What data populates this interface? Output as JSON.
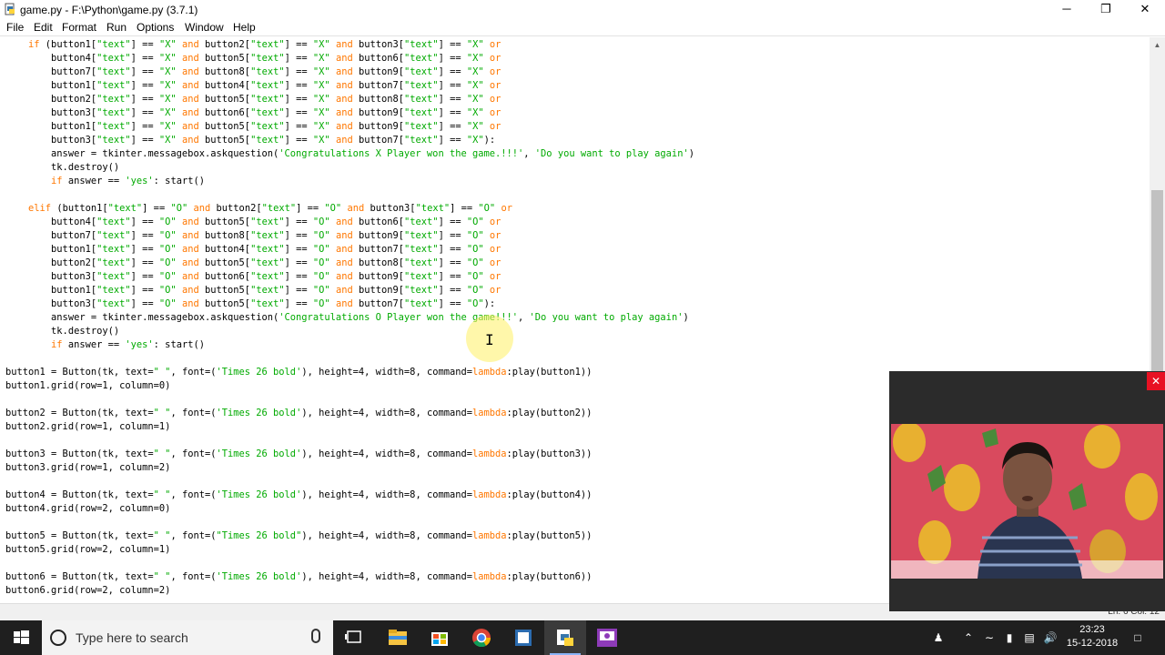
{
  "window": {
    "title": "game.py - F:\\Python\\game.py (3.7.1)",
    "minimize": "─",
    "maximize": "❐",
    "close": "✕"
  },
  "menu": [
    "File",
    "Edit",
    "Format",
    "Run",
    "Options",
    "Window",
    "Help"
  ],
  "code_lines": [
    [
      [
        "    ",
        ""
      ],
      [
        "if",
        "kw"
      ],
      [
        " (button1[",
        ""
      ],
      [
        "\"text\"",
        "str"
      ],
      [
        "] == ",
        ""
      ],
      [
        "\"X\"",
        "str"
      ],
      [
        " ",
        ""
      ],
      [
        "and",
        "kw"
      ],
      [
        " button2[",
        ""
      ],
      [
        "\"text\"",
        "str"
      ],
      [
        "] == ",
        ""
      ],
      [
        "\"X\"",
        "str"
      ],
      [
        " ",
        ""
      ],
      [
        "and",
        "kw"
      ],
      [
        " button3[",
        ""
      ],
      [
        "\"text\"",
        "str"
      ],
      [
        "] == ",
        ""
      ],
      [
        "\"X\"",
        "str"
      ],
      [
        " ",
        ""
      ],
      [
        "or",
        "kw"
      ]
    ],
    [
      [
        "        button4[",
        ""
      ],
      [
        "\"text\"",
        "str"
      ],
      [
        "] == ",
        ""
      ],
      [
        "\"X\"",
        "str"
      ],
      [
        " ",
        ""
      ],
      [
        "and",
        "kw"
      ],
      [
        " button5[",
        ""
      ],
      [
        "\"text\"",
        "str"
      ],
      [
        "] == ",
        ""
      ],
      [
        "\"X\"",
        "str"
      ],
      [
        " ",
        ""
      ],
      [
        "and",
        "kw"
      ],
      [
        " button6[",
        ""
      ],
      [
        "\"text\"",
        "str"
      ],
      [
        "] == ",
        ""
      ],
      [
        "\"X\"",
        "str"
      ],
      [
        " ",
        ""
      ],
      [
        "or",
        "kw"
      ]
    ],
    [
      [
        "        button7[",
        ""
      ],
      [
        "\"text\"",
        "str"
      ],
      [
        "] == ",
        ""
      ],
      [
        "\"X\"",
        "str"
      ],
      [
        " ",
        ""
      ],
      [
        "and",
        "kw"
      ],
      [
        " button8[",
        ""
      ],
      [
        "\"text\"",
        "str"
      ],
      [
        "] == ",
        ""
      ],
      [
        "\"X\"",
        "str"
      ],
      [
        " ",
        ""
      ],
      [
        "and",
        "kw"
      ],
      [
        " button9[",
        ""
      ],
      [
        "\"text\"",
        "str"
      ],
      [
        "] == ",
        ""
      ],
      [
        "\"X\"",
        "str"
      ],
      [
        " ",
        ""
      ],
      [
        "or",
        "kw"
      ]
    ],
    [
      [
        "        button1[",
        ""
      ],
      [
        "\"text\"",
        "str"
      ],
      [
        "] == ",
        ""
      ],
      [
        "\"X\"",
        "str"
      ],
      [
        " ",
        ""
      ],
      [
        "and",
        "kw"
      ],
      [
        " button4[",
        ""
      ],
      [
        "\"text\"",
        "str"
      ],
      [
        "] == ",
        ""
      ],
      [
        "\"X\"",
        "str"
      ],
      [
        " ",
        ""
      ],
      [
        "and",
        "kw"
      ],
      [
        " button7[",
        ""
      ],
      [
        "\"text\"",
        "str"
      ],
      [
        "] == ",
        ""
      ],
      [
        "\"X\"",
        "str"
      ],
      [
        " ",
        ""
      ],
      [
        "or",
        "kw"
      ]
    ],
    [
      [
        "        button2[",
        ""
      ],
      [
        "\"text\"",
        "str"
      ],
      [
        "] == ",
        ""
      ],
      [
        "\"X\"",
        "str"
      ],
      [
        " ",
        ""
      ],
      [
        "and",
        "kw"
      ],
      [
        " button5[",
        ""
      ],
      [
        "\"text\"",
        "str"
      ],
      [
        "] == ",
        ""
      ],
      [
        "\"X\"",
        "str"
      ],
      [
        " ",
        ""
      ],
      [
        "and",
        "kw"
      ],
      [
        " button8[",
        ""
      ],
      [
        "\"text\"",
        "str"
      ],
      [
        "] == ",
        ""
      ],
      [
        "\"X\"",
        "str"
      ],
      [
        " ",
        ""
      ],
      [
        "or",
        "kw"
      ]
    ],
    [
      [
        "        button3[",
        ""
      ],
      [
        "\"text\"",
        "str"
      ],
      [
        "] == ",
        ""
      ],
      [
        "\"X\"",
        "str"
      ],
      [
        " ",
        ""
      ],
      [
        "and",
        "kw"
      ],
      [
        " button6[",
        ""
      ],
      [
        "\"text\"",
        "str"
      ],
      [
        "] == ",
        ""
      ],
      [
        "\"X\"",
        "str"
      ],
      [
        " ",
        ""
      ],
      [
        "and",
        "kw"
      ],
      [
        " button9[",
        ""
      ],
      [
        "\"text\"",
        "str"
      ],
      [
        "] == ",
        ""
      ],
      [
        "\"X\"",
        "str"
      ],
      [
        " ",
        ""
      ],
      [
        "or",
        "kw"
      ]
    ],
    [
      [
        "        button1[",
        ""
      ],
      [
        "\"text\"",
        "str"
      ],
      [
        "] == ",
        ""
      ],
      [
        "\"X\"",
        "str"
      ],
      [
        " ",
        ""
      ],
      [
        "and",
        "kw"
      ],
      [
        " button5[",
        ""
      ],
      [
        "\"text\"",
        "str"
      ],
      [
        "] == ",
        ""
      ],
      [
        "\"X\"",
        "str"
      ],
      [
        " ",
        ""
      ],
      [
        "and",
        "kw"
      ],
      [
        " button9[",
        ""
      ],
      [
        "\"text\"",
        "str"
      ],
      [
        "] == ",
        ""
      ],
      [
        "\"X\"",
        "str"
      ],
      [
        " ",
        ""
      ],
      [
        "or",
        "kw"
      ]
    ],
    [
      [
        "        button3[",
        ""
      ],
      [
        "\"text\"",
        "str"
      ],
      [
        "] == ",
        ""
      ],
      [
        "\"X\"",
        "str"
      ],
      [
        " ",
        ""
      ],
      [
        "and",
        "kw"
      ],
      [
        " button5[",
        ""
      ],
      [
        "\"text\"",
        "str"
      ],
      [
        "] == ",
        ""
      ],
      [
        "\"X\"",
        "str"
      ],
      [
        " ",
        ""
      ],
      [
        "and",
        "kw"
      ],
      [
        " button7[",
        ""
      ],
      [
        "\"text\"",
        "str"
      ],
      [
        "] == ",
        ""
      ],
      [
        "\"X\"",
        "str"
      ],
      [
        "):",
        ""
      ]
    ],
    [
      [
        "        answer = tkinter.messagebox.askquestion(",
        ""
      ],
      [
        "'Congratulations X Player won the game.!!!'",
        "str"
      ],
      [
        ", ",
        ""
      ],
      [
        "'Do you want to play again'",
        "str"
      ],
      [
        ")",
        ""
      ]
    ],
    [
      [
        "        tk.destroy()",
        ""
      ]
    ],
    [
      [
        "        ",
        ""
      ],
      [
        "if",
        "kw"
      ],
      [
        " answer == ",
        ""
      ],
      [
        "'yes'",
        "str"
      ],
      [
        ": start()",
        ""
      ]
    ],
    [
      [
        "",
        ""
      ]
    ],
    [
      [
        "    ",
        ""
      ],
      [
        "elif",
        "kw"
      ],
      [
        " (button1[",
        ""
      ],
      [
        "\"text\"",
        "str"
      ],
      [
        "] == ",
        ""
      ],
      [
        "\"O\"",
        "str"
      ],
      [
        " ",
        ""
      ],
      [
        "and",
        "kw"
      ],
      [
        " button2[",
        ""
      ],
      [
        "\"text\"",
        "str"
      ],
      [
        "] == ",
        ""
      ],
      [
        "\"O\"",
        "str"
      ],
      [
        " ",
        ""
      ],
      [
        "and",
        "kw"
      ],
      [
        " button3[",
        ""
      ],
      [
        "\"text\"",
        "str"
      ],
      [
        "] == ",
        ""
      ],
      [
        "\"O\"",
        "str"
      ],
      [
        " ",
        ""
      ],
      [
        "or",
        "kw"
      ]
    ],
    [
      [
        "        button4[",
        ""
      ],
      [
        "\"text\"",
        "str"
      ],
      [
        "] == ",
        ""
      ],
      [
        "\"O\"",
        "str"
      ],
      [
        " ",
        ""
      ],
      [
        "and",
        "kw"
      ],
      [
        " button5[",
        ""
      ],
      [
        "\"text\"",
        "str"
      ],
      [
        "] == ",
        ""
      ],
      [
        "\"O\"",
        "str"
      ],
      [
        " ",
        ""
      ],
      [
        "and",
        "kw"
      ],
      [
        " button6[",
        ""
      ],
      [
        "\"text\"",
        "str"
      ],
      [
        "] == ",
        ""
      ],
      [
        "\"O\"",
        "str"
      ],
      [
        " ",
        ""
      ],
      [
        "or",
        "kw"
      ]
    ],
    [
      [
        "        button7[",
        ""
      ],
      [
        "\"text\"",
        "str"
      ],
      [
        "] == ",
        ""
      ],
      [
        "\"O\"",
        "str"
      ],
      [
        " ",
        ""
      ],
      [
        "and",
        "kw"
      ],
      [
        " button8[",
        ""
      ],
      [
        "\"text\"",
        "str"
      ],
      [
        "] == ",
        ""
      ],
      [
        "\"O\"",
        "str"
      ],
      [
        " ",
        ""
      ],
      [
        "and",
        "kw"
      ],
      [
        " button9[",
        ""
      ],
      [
        "\"text\"",
        "str"
      ],
      [
        "] == ",
        ""
      ],
      [
        "\"O\"",
        "str"
      ],
      [
        " ",
        ""
      ],
      [
        "or",
        "kw"
      ]
    ],
    [
      [
        "        button1[",
        ""
      ],
      [
        "\"text\"",
        "str"
      ],
      [
        "] == ",
        ""
      ],
      [
        "\"O\"",
        "str"
      ],
      [
        " ",
        ""
      ],
      [
        "and",
        "kw"
      ],
      [
        " button4[",
        ""
      ],
      [
        "\"text\"",
        "str"
      ],
      [
        "] == ",
        ""
      ],
      [
        "\"O\"",
        "str"
      ],
      [
        " ",
        ""
      ],
      [
        "and",
        "kw"
      ],
      [
        " button7[",
        ""
      ],
      [
        "\"text\"",
        "str"
      ],
      [
        "] == ",
        ""
      ],
      [
        "\"O\"",
        "str"
      ],
      [
        " ",
        ""
      ],
      [
        "or",
        "kw"
      ]
    ],
    [
      [
        "        button2[",
        ""
      ],
      [
        "\"text\"",
        "str"
      ],
      [
        "] == ",
        ""
      ],
      [
        "\"O\"",
        "str"
      ],
      [
        " ",
        ""
      ],
      [
        "and",
        "kw"
      ],
      [
        " button5[",
        ""
      ],
      [
        "\"text\"",
        "str"
      ],
      [
        "] == ",
        ""
      ],
      [
        "\"O\"",
        "str"
      ],
      [
        " ",
        ""
      ],
      [
        "and",
        "kw"
      ],
      [
        " button8[",
        ""
      ],
      [
        "\"text\"",
        "str"
      ],
      [
        "] == ",
        ""
      ],
      [
        "\"O\"",
        "str"
      ],
      [
        " ",
        ""
      ],
      [
        "or",
        "kw"
      ]
    ],
    [
      [
        "        button3[",
        ""
      ],
      [
        "\"text\"",
        "str"
      ],
      [
        "] == ",
        ""
      ],
      [
        "\"O\"",
        "str"
      ],
      [
        " ",
        ""
      ],
      [
        "and",
        "kw"
      ],
      [
        " button6[",
        ""
      ],
      [
        "\"text\"",
        "str"
      ],
      [
        "] == ",
        ""
      ],
      [
        "\"O\"",
        "str"
      ],
      [
        " ",
        ""
      ],
      [
        "and",
        "kw"
      ],
      [
        " button9[",
        ""
      ],
      [
        "\"text\"",
        "str"
      ],
      [
        "] == ",
        ""
      ],
      [
        "\"O\"",
        "str"
      ],
      [
        " ",
        ""
      ],
      [
        "or",
        "kw"
      ]
    ],
    [
      [
        "        button1[",
        ""
      ],
      [
        "\"text\"",
        "str"
      ],
      [
        "] == ",
        ""
      ],
      [
        "\"O\"",
        "str"
      ],
      [
        " ",
        ""
      ],
      [
        "and",
        "kw"
      ],
      [
        " button5[",
        ""
      ],
      [
        "\"text\"",
        "str"
      ],
      [
        "] == ",
        ""
      ],
      [
        "\"O\"",
        "str"
      ],
      [
        " ",
        ""
      ],
      [
        "and",
        "kw"
      ],
      [
        " button9[",
        ""
      ],
      [
        "\"text\"",
        "str"
      ],
      [
        "] == ",
        ""
      ],
      [
        "\"O\"",
        "str"
      ],
      [
        " ",
        ""
      ],
      [
        "or",
        "kw"
      ]
    ],
    [
      [
        "        button3[",
        ""
      ],
      [
        "\"text\"",
        "str"
      ],
      [
        "] == ",
        ""
      ],
      [
        "\"O\"",
        "str"
      ],
      [
        " ",
        ""
      ],
      [
        "and",
        "kw"
      ],
      [
        " button5[",
        ""
      ],
      [
        "\"text\"",
        "str"
      ],
      [
        "] == ",
        ""
      ],
      [
        "\"O\"",
        "str"
      ],
      [
        " ",
        ""
      ],
      [
        "and",
        "kw"
      ],
      [
        " button7[",
        ""
      ],
      [
        "\"text\"",
        "str"
      ],
      [
        "] == ",
        ""
      ],
      [
        "\"O\"",
        "str"
      ],
      [
        "):",
        ""
      ]
    ],
    [
      [
        "        answer = tkinter.messagebox.askquestion(",
        ""
      ],
      [
        "'Congratulations O Player won the game!!!'",
        "str"
      ],
      [
        ", ",
        ""
      ],
      [
        "'Do you want to play again'",
        "str"
      ],
      [
        ")",
        ""
      ]
    ],
    [
      [
        "        tk.destroy()",
        ""
      ]
    ],
    [
      [
        "        ",
        ""
      ],
      [
        "if",
        "kw"
      ],
      [
        " answer == ",
        ""
      ],
      [
        "'yes'",
        "str"
      ],
      [
        ": start()",
        ""
      ]
    ],
    [
      [
        "",
        ""
      ]
    ],
    [
      [
        "button1 = Button(tk, text=",
        ""
      ],
      [
        "\" \"",
        "str"
      ],
      [
        ", font=(",
        ""
      ],
      [
        "'Times 26 bold'",
        "str"
      ],
      [
        "), height=4, width=8, command=",
        ""
      ],
      [
        "lambda",
        "kw"
      ],
      [
        ":play(button1))",
        ""
      ]
    ],
    [
      [
        "button1.grid(row=1, column=0)",
        ""
      ]
    ],
    [
      [
        "",
        ""
      ]
    ],
    [
      [
        "button2 = Button(tk, text=",
        ""
      ],
      [
        "\" \"",
        "str"
      ],
      [
        ", font=(",
        ""
      ],
      [
        "'Times 26 bold'",
        "str"
      ],
      [
        "), height=4, width=8, command=",
        ""
      ],
      [
        "lambda",
        "kw"
      ],
      [
        ":play(button2))",
        ""
      ]
    ],
    [
      [
        "button2.grid(row=1, column=1)",
        ""
      ]
    ],
    [
      [
        "",
        ""
      ]
    ],
    [
      [
        "button3 = Button(tk, text=",
        ""
      ],
      [
        "\" \"",
        "str"
      ],
      [
        ", font=(",
        ""
      ],
      [
        "'Times 26 bold'",
        "str"
      ],
      [
        "), height=4, width=8, command=",
        ""
      ],
      [
        "lambda",
        "kw"
      ],
      [
        ":play(button3))",
        ""
      ]
    ],
    [
      [
        "button3.grid(row=1, column=2)",
        ""
      ]
    ],
    [
      [
        "",
        ""
      ]
    ],
    [
      [
        "button4 = Button(tk, text=",
        ""
      ],
      [
        "\" \"",
        "str"
      ],
      [
        ", font=(",
        ""
      ],
      [
        "'Times 26 bold'",
        "str"
      ],
      [
        "), height=4, width=8, command=",
        ""
      ],
      [
        "lambda",
        "kw"
      ],
      [
        ":play(button4))",
        ""
      ]
    ],
    [
      [
        "button4.grid(row=2, column=0)",
        ""
      ]
    ],
    [
      [
        "",
        ""
      ]
    ],
    [
      [
        "button5 = Button(tk, text=",
        ""
      ],
      [
        "\" \"",
        "str"
      ],
      [
        ", font=(",
        ""
      ],
      [
        "\"Times 26 bold\"",
        "str"
      ],
      [
        "), height=4, width=8, command=",
        ""
      ],
      [
        "lambda",
        "kw"
      ],
      [
        ":play(button5))",
        ""
      ]
    ],
    [
      [
        "button5.grid(row=2, column=1)",
        ""
      ]
    ],
    [
      [
        "",
        ""
      ]
    ],
    [
      [
        "button6 = Button(tk, text=",
        ""
      ],
      [
        "\" \"",
        "str"
      ],
      [
        ", font=(",
        ""
      ],
      [
        "'Times 26 bold'",
        "str"
      ],
      [
        "), height=4, width=8, command=",
        ""
      ],
      [
        "lambda",
        "kw"
      ],
      [
        ":play(button6))",
        ""
      ]
    ],
    [
      [
        "button6.grid(row=2, column=2)",
        ""
      ]
    ]
  ],
  "status": {
    "position": "Ln: 6   Col: 12"
  },
  "taskbar": {
    "search_placeholder": "Type here to search",
    "time": "23:23",
    "date": "15-12-2018"
  },
  "colors": {
    "keyword": "#ff7700",
    "string": "#00aa00",
    "taskbar": "#1f1f1f"
  }
}
